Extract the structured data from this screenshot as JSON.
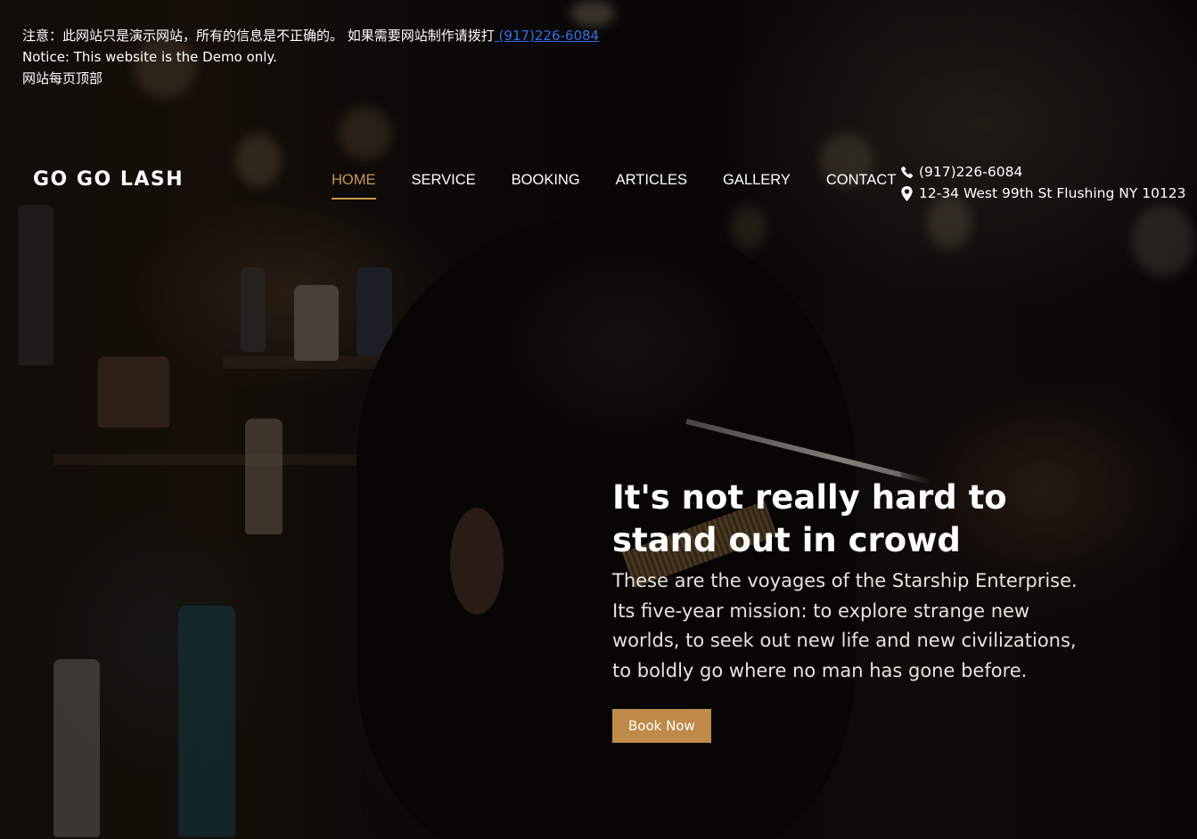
{
  "notice": {
    "line1_text": "注意：此网站只是演示网站，所有的信息是不正确的。 如果需要网站制作请拨打",
    "line1_phone": " (917)226-6084",
    "line2": "Notice: This website is the Demo only.",
    "line3": "网站每页顶部"
  },
  "header": {
    "logo": "GO GO LASH",
    "nav": [
      {
        "label": "HOME",
        "active": true
      },
      {
        "label": "SERVICE",
        "active": false
      },
      {
        "label": "BOOKING",
        "active": false
      },
      {
        "label": "ARTICLES",
        "active": false
      },
      {
        "label": "GALLERY",
        "active": false
      },
      {
        "label": "CONTACT",
        "active": false
      }
    ],
    "phone": "(917)226-6084",
    "address": "12-34 West 99th St Flushing NY 10123",
    "phone_icon": "phone-icon",
    "address_icon": "map-marker-icon"
  },
  "hero": {
    "title": "It's not really hard to stand out in crowd",
    "text": "These are the voyages of the Starship Enterprise. Its five-year mission: to explore strange new worlds, to seek out new life and new civilizations, to boldly go where no man has gone before.",
    "button": "Book Now"
  },
  "colors": {
    "accent": "#c89550",
    "button": "#c08a48",
    "link": "#2f6fe6"
  }
}
